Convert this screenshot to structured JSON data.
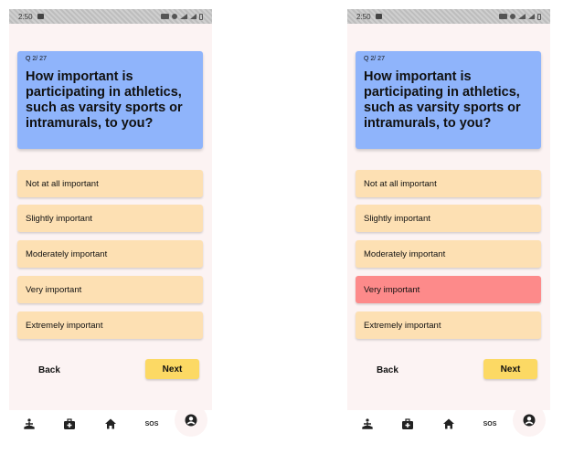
{
  "status_bar": {
    "time": "2:50"
  },
  "screens": [
    {
      "question_count": "Q 2/ 27",
      "question": "How important is participating in athletics, such as varsity sports or intramurals, to you?",
      "options": [
        {
          "label": "Not at all important",
          "selected": false
        },
        {
          "label": "Slightly important",
          "selected": false
        },
        {
          "label": "Moderately important",
          "selected": false
        },
        {
          "label": "Very important",
          "selected": false
        },
        {
          "label": "Extremely important",
          "selected": false
        }
      ],
      "back_label": "Back",
      "next_label": "Next"
    },
    {
      "question_count": "Q 2/ 27",
      "question": "How important is participating in athletics, such as varsity sports or intramurals, to you?",
      "options": [
        {
          "label": "Not at all important",
          "selected": false
        },
        {
          "label": "Slightly important",
          "selected": false
        },
        {
          "label": "Moderately important",
          "selected": false
        },
        {
          "label": "Very important",
          "selected": true
        },
        {
          "label": "Extremely important",
          "selected": false
        }
      ],
      "back_label": "Back",
      "next_label": "Next"
    }
  ],
  "nav": {
    "items": [
      {
        "icon": "meditation-icon"
      },
      {
        "icon": "medical-kit-icon"
      },
      {
        "icon": "home-icon"
      },
      {
        "icon": "sos-icon",
        "label": "SOS"
      },
      {
        "icon": "profile-icon"
      }
    ]
  },
  "colors": {
    "question_card": "#8fb4fb",
    "option": "#fde0b3",
    "option_selected": "#fd8a8a",
    "next_button": "#fcd964",
    "background": "#fcf3f3"
  }
}
